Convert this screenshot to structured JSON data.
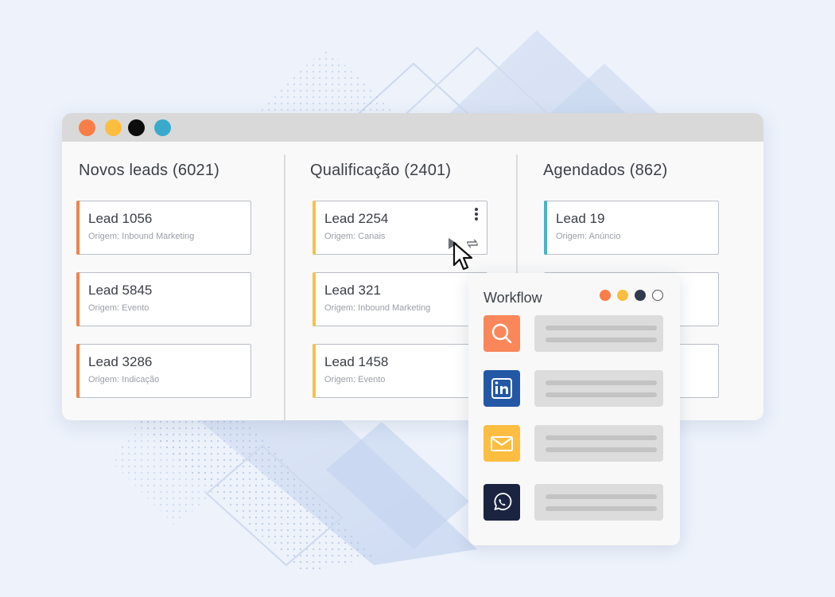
{
  "window": {
    "traffic_lights": [
      "#f97d47",
      "#fdbd3e",
      "#0d0d0d",
      "#3aaacc"
    ]
  },
  "columns": [
    {
      "title": "Novos leads (6021)",
      "accent": "#f0844e",
      "cards": [
        {
          "title": "Lead 1056",
          "origin": "Origem: Inbound Marketing"
        },
        {
          "title": "Lead 5845",
          "origin": "Origem: Evento"
        },
        {
          "title": "Lead 3286",
          "origin": "Origem: Indicação"
        }
      ]
    },
    {
      "title": "Qualificação (2401)",
      "accent": "#f4c24a",
      "cards": [
        {
          "title": "Lead 2254",
          "origin": "Origem: Canais"
        },
        {
          "title": "Lead 321",
          "origin": "Origem: Inbound Marketing"
        },
        {
          "title": "Lead 1458",
          "origin": "Origem: Evento"
        }
      ]
    },
    {
      "title": "Agendados (862)",
      "accent": "#4ab3c6",
      "cards": [
        {
          "title": "Lead 19",
          "origin": "Origem: Anúncio"
        }
      ]
    }
  ],
  "workflow": {
    "title": "Workflow",
    "dots": [
      "#f97d47",
      "#fdbd3e",
      "#323a4e",
      "#ffffff"
    ],
    "steps": [
      {
        "icon": "search-icon",
        "color": "#f9875a"
      },
      {
        "icon": "linkedin-icon",
        "color": "#2358a6"
      },
      {
        "icon": "mail-icon",
        "color": "#fcbd41"
      },
      {
        "icon": "whatsapp-icon",
        "color": "#1a2440"
      }
    ]
  }
}
